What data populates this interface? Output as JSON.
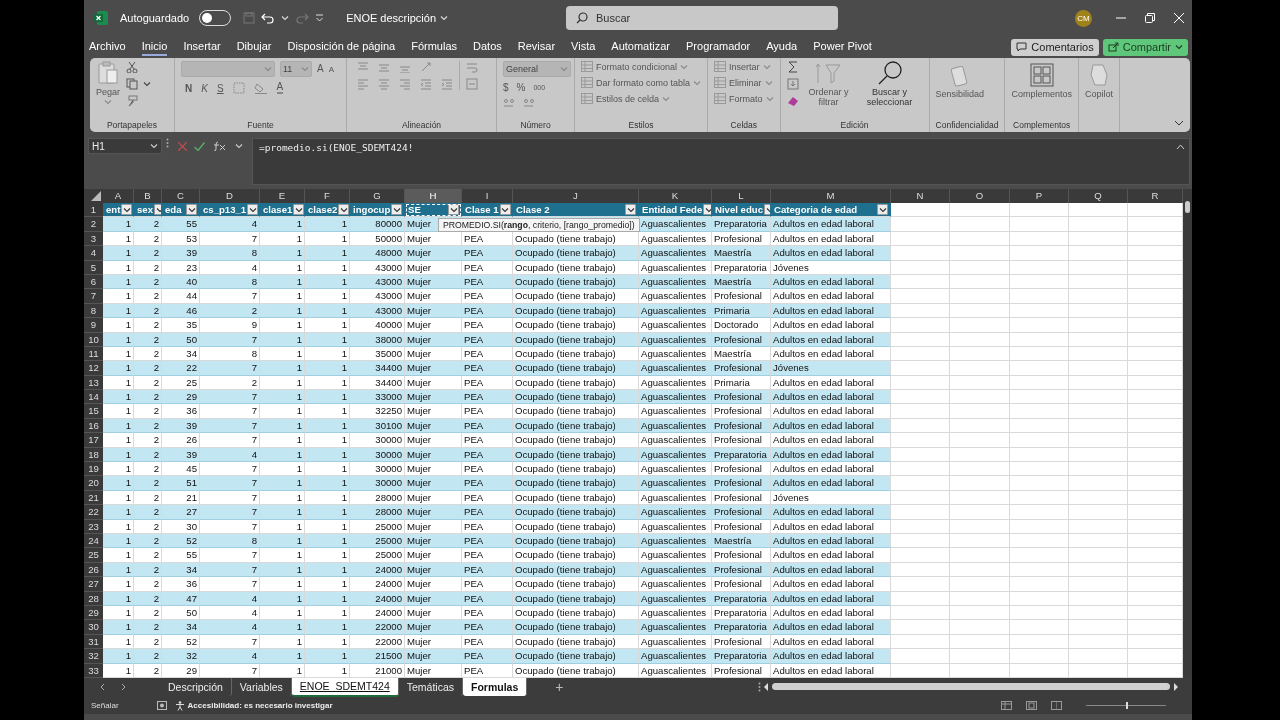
{
  "title_bar": {
    "autosave_label": "Autoguardado",
    "autosave_on": false,
    "document": "ENOE descripción",
    "search": {
      "placeholder": "Buscar"
    },
    "avatar": "CM"
  },
  "menu": {
    "tabs": [
      {
        "label": "Archivo",
        "selected": false
      },
      {
        "label": "Inicio",
        "selected": true
      },
      {
        "label": "Insertar",
        "selected": false
      },
      {
        "label": "Dibujar",
        "selected": false
      },
      {
        "label": "Disposición de página",
        "selected": false
      },
      {
        "label": "Fórmulas",
        "selected": false
      },
      {
        "label": "Datos",
        "selected": false
      },
      {
        "label": "Revisar",
        "selected": false
      },
      {
        "label": "Vista",
        "selected": false
      },
      {
        "label": "Automatizar",
        "selected": false
      },
      {
        "label": "Programador",
        "selected": false
      },
      {
        "label": "Ayuda",
        "selected": false
      },
      {
        "label": "Power Pivot",
        "selected": false
      }
    ],
    "comments": "Comentarios",
    "share": "Compartir"
  },
  "ribbon": {
    "groups": [
      {
        "kind": "clipboard",
        "label": "Portapapeles",
        "paste": "Pegar",
        "disabled": true
      },
      {
        "kind": "font",
        "label": "Fuente",
        "font_size": "11",
        "grow": "A",
        "shrink": "A",
        "bold": "N",
        "italic": "K",
        "underline": "S",
        "font_color_letter": "A"
      },
      {
        "kind": "alignment",
        "label": "Alineación"
      },
      {
        "kind": "number",
        "label": "Número",
        "format": "General",
        "currency": "$",
        "percent": "%",
        "thousands": "000"
      },
      {
        "kind": "list",
        "label": "Estilos",
        "items": [
          {
            "label": "Formato condicional",
            "disabled": true
          },
          {
            "label": "Dar formato como tabla",
            "disabled": true
          },
          {
            "label": "Estilos de celda",
            "disabled": true
          }
        ]
      },
      {
        "kind": "list",
        "label": "Celdas",
        "items": [
          {
            "label": "Insertar",
            "disabled": true
          },
          {
            "label": "Eliminar",
            "disabled": true
          },
          {
            "label": "Formato",
            "disabled": true
          }
        ]
      },
      {
        "kind": "editing",
        "label": "Edición",
        "items": [
          {
            "label": "Ordenar y filtrar",
            "disabled": true
          },
          {
            "label": "Buscar y seleccionar",
            "disabled": false
          }
        ]
      },
      {
        "kind": "big",
        "label": "Confidencialidad",
        "button": "Sensibilidad",
        "disabled": true
      },
      {
        "kind": "big",
        "label": "Complementos",
        "button": "Complementos",
        "disabled": true
      },
      {
        "kind": "big",
        "button": "Copilot",
        "disabled": true
      }
    ]
  },
  "formula_bar": {
    "name_box": "H1",
    "formula": "=promedio.si(ENOE_SDEMT424!"
  },
  "sheet": {
    "columns": [
      {
        "label": "A",
        "selected": false
      },
      {
        "label": "B",
        "selected": false
      },
      {
        "label": "C",
        "selected": false
      },
      {
        "label": "D",
        "selected": false
      },
      {
        "label": "E",
        "selected": false
      },
      {
        "label": "F",
        "selected": false
      },
      {
        "label": "G",
        "selected": false
      },
      {
        "label": "H",
        "selected": true
      },
      {
        "label": "I",
        "selected": false
      },
      {
        "label": "J",
        "selected": false
      },
      {
        "label": "K",
        "selected": false
      },
      {
        "label": "L",
        "selected": false
      },
      {
        "label": "M",
        "selected": false
      },
      {
        "label": "N",
        "selected": false
      },
      {
        "label": "O",
        "selected": false
      },
      {
        "label": "P",
        "selected": false
      },
      {
        "label": "Q",
        "selected": false
      },
      {
        "label": "R",
        "selected": false
      }
    ],
    "header": {
      "number": "1",
      "cells": [
        "ent",
        "sex",
        "eda",
        "cs_p13_1",
        "clase1",
        "clase2",
        "ingocup",
        "SE",
        "Clase 1",
        "Clase 2",
        "Entidad Fede",
        "Nivel educ",
        "Categoria de edad"
      ]
    },
    "rows": [
      {
        "number": "2",
        "cells": [
          "1",
          "2",
          "55",
          "4",
          "1",
          "1",
          "80000",
          "Mujer",
          null,
          null,
          "Aguascalientes",
          "Preparatoria",
          "Adultos en edad laboral"
        ]
      },
      {
        "number": "3",
        "cells": [
          "1",
          "2",
          "53",
          "7",
          "1",
          "1",
          "50000",
          "Mujer",
          "PEA",
          "Ocupado (tiene trabajo)",
          "Aguascalientes",
          "Profesional",
          "Adultos en edad laboral"
        ]
      },
      {
        "number": "4",
        "cells": [
          "1",
          "2",
          "39",
          "8",
          "1",
          "1",
          "48000",
          "Mujer",
          "PEA",
          "Ocupado (tiene trabajo)",
          "Aguascalientes",
          "Maestría",
          "Adultos en edad laboral"
        ]
      },
      {
        "number": "5",
        "cells": [
          "1",
          "2",
          "23",
          "4",
          "1",
          "1",
          "43000",
          "Mujer",
          "PEA",
          "Ocupado (tiene trabajo)",
          "Aguascalientes",
          "Preparatoria",
          "Jóvenes"
        ]
      },
      {
        "number": "6",
        "cells": [
          "1",
          "2",
          "40",
          "8",
          "1",
          "1",
          "43000",
          "Mujer",
          "PEA",
          "Ocupado (tiene trabajo)",
          "Aguascalientes",
          "Maestría",
          "Adultos en edad laboral"
        ]
      },
      {
        "number": "7",
        "cells": [
          "1",
          "2",
          "44",
          "7",
          "1",
          "1",
          "43000",
          "Mujer",
          "PEA",
          "Ocupado (tiene trabajo)",
          "Aguascalientes",
          "Profesional",
          "Adultos en edad laboral"
        ]
      },
      {
        "number": "8",
        "cells": [
          "1",
          "2",
          "46",
          "2",
          "1",
          "1",
          "43000",
          "Mujer",
          "PEA",
          "Ocupado (tiene trabajo)",
          "Aguascalientes",
          "Primaria",
          "Adultos en edad laboral"
        ]
      },
      {
        "number": "9",
        "cells": [
          "1",
          "2",
          "35",
          "9",
          "1",
          "1",
          "40000",
          "Mujer",
          "PEA",
          "Ocupado (tiene trabajo)",
          "Aguascalientes",
          "Doctorado",
          "Adultos en edad laboral"
        ]
      },
      {
        "number": "10",
        "cells": [
          "1",
          "2",
          "50",
          "7",
          "1",
          "1",
          "38000",
          "Mujer",
          "PEA",
          "Ocupado (tiene trabajo)",
          "Aguascalientes",
          "Profesional",
          "Adultos en edad laboral"
        ]
      },
      {
        "number": "11",
        "cells": [
          "1",
          "2",
          "34",
          "8",
          "1",
          "1",
          "35000",
          "Mujer",
          "PEA",
          "Ocupado (tiene trabajo)",
          "Aguascalientes",
          "Maestría",
          "Adultos en edad laboral"
        ]
      },
      {
        "number": "12",
        "cells": [
          "1",
          "2",
          "22",
          "7",
          "1",
          "1",
          "34400",
          "Mujer",
          "PEA",
          "Ocupado (tiene trabajo)",
          "Aguascalientes",
          "Profesional",
          "Jóvenes"
        ]
      },
      {
        "number": "13",
        "cells": [
          "1",
          "2",
          "25",
          "2",
          "1",
          "1",
          "34400",
          "Mujer",
          "PEA",
          "Ocupado (tiene trabajo)",
          "Aguascalientes",
          "Primaria",
          "Adultos en edad laboral"
        ]
      },
      {
        "number": "14",
        "cells": [
          "1",
          "2",
          "29",
          "7",
          "1",
          "1",
          "33000",
          "Mujer",
          "PEA",
          "Ocupado (tiene trabajo)",
          "Aguascalientes",
          "Profesional",
          "Adultos en edad laboral"
        ]
      },
      {
        "number": "15",
        "cells": [
          "1",
          "2",
          "36",
          "7",
          "1",
          "1",
          "32250",
          "Mujer",
          "PEA",
          "Ocupado (tiene trabajo)",
          "Aguascalientes",
          "Profesional",
          "Adultos en edad laboral"
        ]
      },
      {
        "number": "16",
        "cells": [
          "1",
          "2",
          "39",
          "7",
          "1",
          "1",
          "30100",
          "Mujer",
          "PEA",
          "Ocupado (tiene trabajo)",
          "Aguascalientes",
          "Profesional",
          "Adultos en edad laboral"
        ]
      },
      {
        "number": "17",
        "cells": [
          "1",
          "2",
          "26",
          "7",
          "1",
          "1",
          "30000",
          "Mujer",
          "PEA",
          "Ocupado (tiene trabajo)",
          "Aguascalientes",
          "Profesional",
          "Adultos en edad laboral"
        ]
      },
      {
        "number": "18",
        "cells": [
          "1",
          "2",
          "39",
          "4",
          "1",
          "1",
          "30000",
          "Mujer",
          "PEA",
          "Ocupado (tiene trabajo)",
          "Aguascalientes",
          "Preparatoria",
          "Adultos en edad laboral"
        ]
      },
      {
        "number": "19",
        "cells": [
          "1",
          "2",
          "45",
          "7",
          "1",
          "1",
          "30000",
          "Mujer",
          "PEA",
          "Ocupado (tiene trabajo)",
          "Aguascalientes",
          "Profesional",
          "Adultos en edad laboral"
        ]
      },
      {
        "number": "20",
        "cells": [
          "1",
          "2",
          "51",
          "7",
          "1",
          "1",
          "30000",
          "Mujer",
          "PEA",
          "Ocupado (tiene trabajo)",
          "Aguascalientes",
          "Profesional",
          "Adultos en edad laboral"
        ]
      },
      {
        "number": "21",
        "cells": [
          "1",
          "2",
          "21",
          "7",
          "1",
          "1",
          "28000",
          "Mujer",
          "PEA",
          "Ocupado (tiene trabajo)",
          "Aguascalientes",
          "Profesional",
          "Jóvenes"
        ]
      },
      {
        "number": "22",
        "cells": [
          "1",
          "2",
          "27",
          "7",
          "1",
          "1",
          "28000",
          "Mujer",
          "PEA",
          "Ocupado (tiene trabajo)",
          "Aguascalientes",
          "Profesional",
          "Adultos en edad laboral"
        ]
      },
      {
        "number": "23",
        "cells": [
          "1",
          "2",
          "30",
          "7",
          "1",
          "1",
          "25000",
          "Mujer",
          "PEA",
          "Ocupado (tiene trabajo)",
          "Aguascalientes",
          "Profesional",
          "Adultos en edad laboral"
        ]
      },
      {
        "number": "24",
        "cells": [
          "1",
          "2",
          "52",
          "8",
          "1",
          "1",
          "25000",
          "Mujer",
          "PEA",
          "Ocupado (tiene trabajo)",
          "Aguascalientes",
          "Maestría",
          "Adultos en edad laboral"
        ]
      },
      {
        "number": "25",
        "cells": [
          "1",
          "2",
          "55",
          "7",
          "1",
          "1",
          "25000",
          "Mujer",
          "PEA",
          "Ocupado (tiene trabajo)",
          "Aguascalientes",
          "Profesional",
          "Adultos en edad laboral"
        ]
      },
      {
        "number": "26",
        "cells": [
          "1",
          "2",
          "34",
          "7",
          "1",
          "1",
          "24000",
          "Mujer",
          "PEA",
          "Ocupado (tiene trabajo)",
          "Aguascalientes",
          "Profesional",
          "Adultos en edad laboral"
        ]
      },
      {
        "number": "27",
        "cells": [
          "1",
          "2",
          "36",
          "7",
          "1",
          "1",
          "24000",
          "Mujer",
          "PEA",
          "Ocupado (tiene trabajo)",
          "Aguascalientes",
          "Profesional",
          "Adultos en edad laboral"
        ]
      },
      {
        "number": "28",
        "cells": [
          "1",
          "2",
          "47",
          "4",
          "1",
          "1",
          "24000",
          "Mujer",
          "PEA",
          "Ocupado (tiene trabajo)",
          "Aguascalientes",
          "Preparatoria",
          "Adultos en edad laboral"
        ]
      },
      {
        "number": "29",
        "cells": [
          "1",
          "2",
          "50",
          "4",
          "1",
          "1",
          "24000",
          "Mujer",
          "PEA",
          "Ocupado (tiene trabajo)",
          "Aguascalientes",
          "Preparatoria",
          "Adultos en edad laboral"
        ]
      },
      {
        "number": "30",
        "cells": [
          "1",
          "2",
          "34",
          "4",
          "1",
          "1",
          "22000",
          "Mujer",
          "PEA",
          "Ocupado (tiene trabajo)",
          "Aguascalientes",
          "Preparatoria",
          "Adultos en edad laboral"
        ]
      },
      {
        "number": "31",
        "cells": [
          "1",
          "2",
          "52",
          "7",
          "1",
          "1",
          "22000",
          "Mujer",
          "PEA",
          "Ocupado (tiene trabajo)",
          "Aguascalientes",
          "Profesional",
          "Adultos en edad laboral"
        ]
      },
      {
        "number": "32",
        "cells": [
          "1",
          "2",
          "32",
          "4",
          "1",
          "1",
          "21500",
          "Mujer",
          "PEA",
          "Ocupado (tiene trabajo)",
          "Aguascalientes",
          "Preparatoria",
          "Adultos en edad laboral"
        ]
      },
      {
        "number": "33",
        "cells": [
          "1",
          "2",
          "29",
          "7",
          "1",
          "1",
          "21000",
          "Mujer",
          "PEA",
          "Ocupado (tiene trabajo)",
          "Aguascalientes",
          "Profesional",
          "Adultos en edad laboral"
        ]
      }
    ],
    "tooltip": "PROMEDIO.SI(**rango**, criterio, [rango_promedio])"
  },
  "sheet_tabs": [
    {
      "label": "Descripción",
      "selected": false,
      "highlighted": false
    },
    {
      "label": "Variables",
      "selected": false,
      "highlighted": false
    },
    {
      "label": "ENOE_SDEMT424",
      "selected": true,
      "highlighted": false
    },
    {
      "label": "Temáticas",
      "selected": false,
      "highlighted": false
    },
    {
      "label": "Formulas",
      "selected": false,
      "highlighted": true
    }
  ],
  "add_sheet": "+",
  "status_bar": {
    "mode": "Señalar",
    "accessibility": "Accesibilidad: es necesario investigar",
    "zoom_slider": {
      "level": 0.5
    }
  }
}
